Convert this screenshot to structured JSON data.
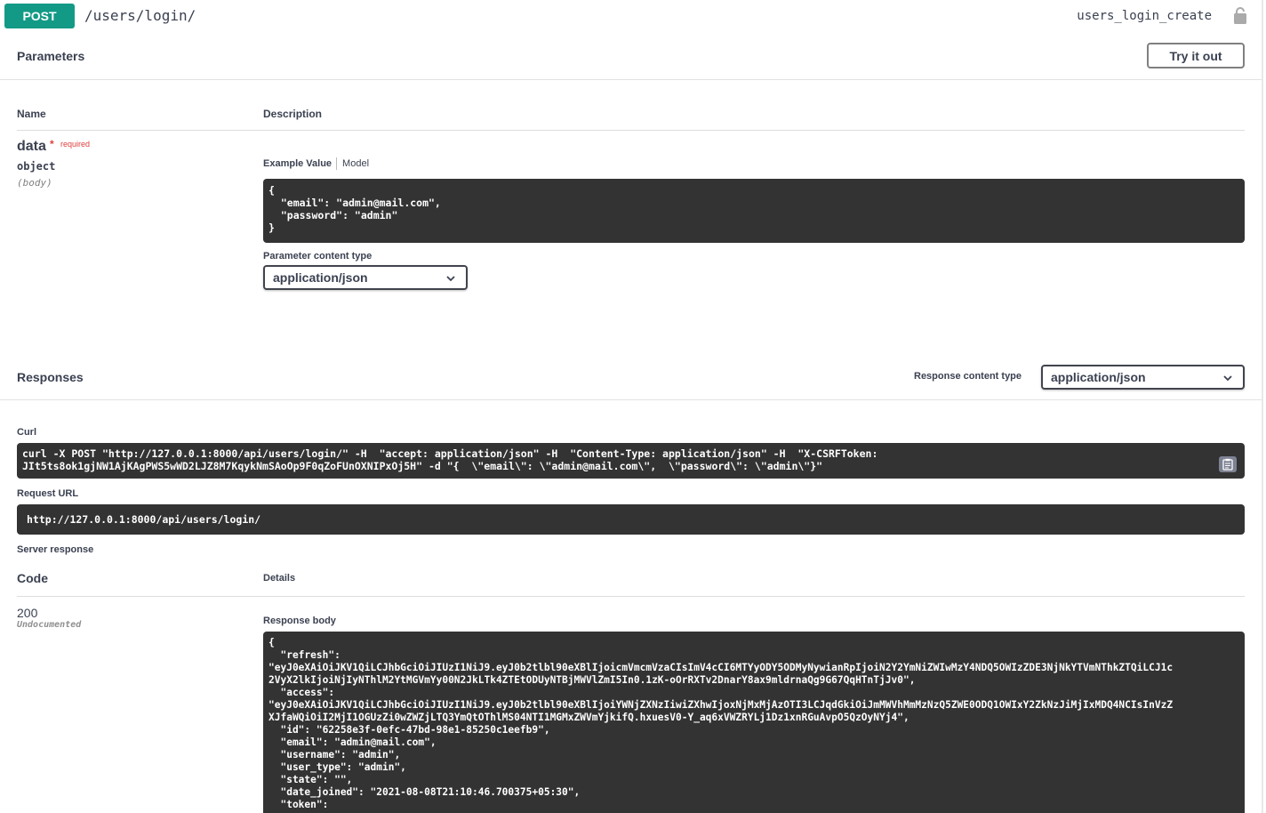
{
  "operation": {
    "method": "POST",
    "path": "/users/login/",
    "operation_id": "users_login_create"
  },
  "parameters": {
    "title": "Parameters",
    "try_label": "Try it out",
    "col_name": "Name",
    "col_description": "Description",
    "param": {
      "name": "data",
      "required_star": "*",
      "required_text": "required",
      "type": "object",
      "in": "(body)"
    },
    "example_tab": "Example Value",
    "model_tab": "Model",
    "example_value": "{\n  \"email\": \"admin@mail.com\",\n  \"password\": \"admin\"\n}",
    "content_type_label": "Parameter content type",
    "content_type_value": "application/json"
  },
  "responses": {
    "title": "Responses",
    "content_type_label": "Response content type",
    "content_type_value": "application/json",
    "curl_label": "Curl",
    "curl_value": "curl -X POST \"http://127.0.0.1:8000/api/users/login/\" -H  \"accept: application/json\" -H  \"Content-Type: application/json\" -H  \"X-CSRFToken:\nJIt5ts8ok1gjNW1AjKAgPWS5wWD2LJZ8M7KqykNmSAoOp9F0qZoFUnOXNIPxOj5H\" -d \"{  \\\"email\\\": \\\"admin@mail.com\\\",  \\\"password\\\": \\\"admin\\\"}\"",
    "request_url_label": "Request URL",
    "request_url_value": "http://127.0.0.1:8000/api/users/login/",
    "server_response_label": "Server response",
    "col_code": "Code",
    "col_details": "Details",
    "status_code": "200",
    "status_note": "Undocumented",
    "response_body_label": "Response body",
    "response_body": "{\n  \"refresh\":\n\"eyJ0eXAiOiJKV1QiLCJhbGciOiJIUzI1NiJ9.eyJ0b2tlbl90eXBlIjoicmVmcmVzaCIsImV4cCI6MTYyODY5ODMyNywianRpIjoiN2Y2YmNiZWIwMzY4NDQ5OWIzZDE3NjNkYTVmNThkZTQiLCJ1c\n2VyX2lkIjoiNjIyNThlM2YtMGVmYy00N2JkLTk4ZTEtODUyNTBjMWVlZmI5In0.1zK-oOrRXTv2DnarY8ax9mldrnaQg9G67QqHTnTjJv0\",\n  \"access\":\n\"eyJ0eXAiOiJKV1QiLCJhbGciOiJIUzI1NiJ9.eyJ0b2tlbl90eXBlIjoiYWNjZXNzIiwiZXhwIjoxNjMxMjAzOTI3LCJqdGkiOiJmMWVhMmMzNzQ5ZWE0ODQ1OWIxY2ZkNzJiMjIxMDQ4NCIsInVzZ\nXJfaWQiOiI2MjI1OGUzZi0wZWZjLTQ3YmQtOThlMS04NTI1MGMxZWVmYjkifQ.hxuesV0-Y_aq6xVWZRYLj1Dz1xnRGuAvpO5QzOyNYj4\",\n  \"id\": \"62258e3f-0efc-47bd-98e1-85250c1eefb9\",\n  \"email\": \"admin@mail.com\",\n  \"username\": \"admin\",\n  \"user_type\": \"admin\",\n  \"state\": \"\",\n  \"date_joined\": \"2021-08-08T21:10:46.700375+05:30\",\n  \"token\":"
  }
}
